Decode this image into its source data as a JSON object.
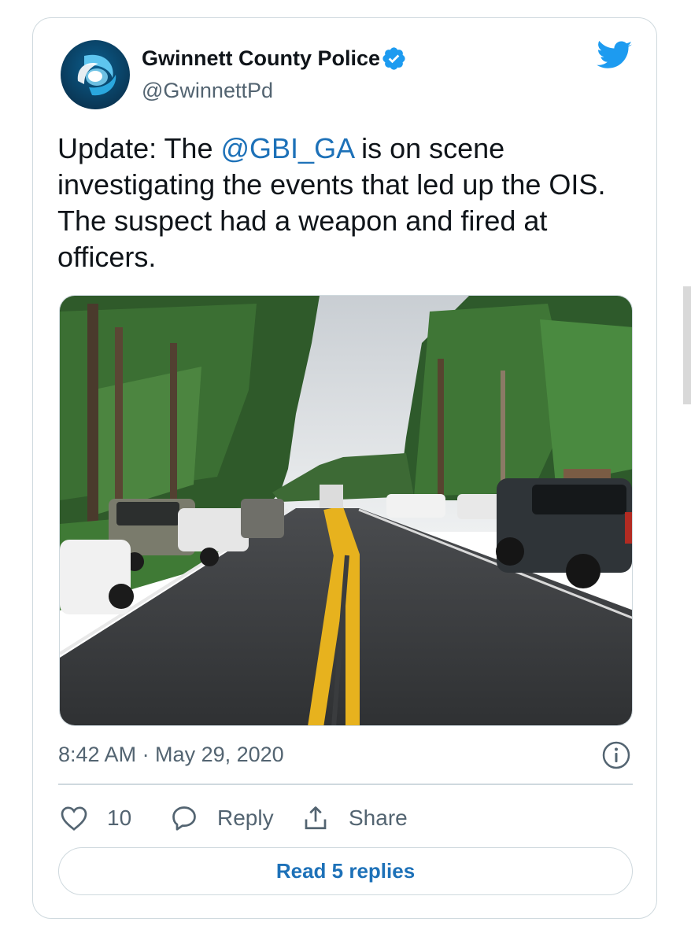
{
  "author": {
    "display_name": "Gwinnett County Police",
    "handle": "@GwinnettPd",
    "verified": true,
    "avatar_icon": "gwinnett-police-logo",
    "brand_color": "#1d71b8"
  },
  "tweet": {
    "text_before": "Update: The ",
    "mention": "@GBI_GA",
    "text_after": " is on scene investigating the events that led up the OIS. The suspect had a weapon and fired at officers.",
    "photo_icon": "road-scene-photo",
    "timestamp": "8:42 AM · May 29, 2020"
  },
  "actions": {
    "like_count": "10",
    "reply_label": "Reply",
    "share_label": "Share",
    "read_replies_label": "Read 5 replies"
  },
  "icons": {
    "platform": "twitter-bird-icon",
    "info": "info-icon",
    "like": "heart-icon",
    "reply": "speech-bubble-icon",
    "share": "share-icon"
  },
  "colors": {
    "twitter_blue": "#1d9bf0",
    "link_blue": "#1d71b8",
    "secondary_text": "#536471",
    "border": "#cfd9de"
  }
}
